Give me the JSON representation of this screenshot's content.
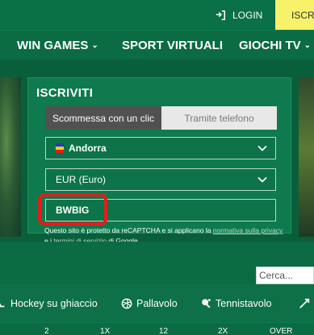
{
  "topbar": {
    "login_label": "LOGIN",
    "register_label": "ISCRI"
  },
  "nav": {
    "items": [
      {
        "label": "WIN GAMES",
        "has_dropdown": true
      },
      {
        "label": "SPORT VIRTUALI",
        "has_dropdown": false
      },
      {
        "label": "GIOCHI TV",
        "has_dropdown": true
      }
    ]
  },
  "registration": {
    "title": "ISCRIVITI",
    "tabs": [
      {
        "label": "Scommessa con un clic",
        "active": true
      },
      {
        "label": "Tramite telefono",
        "active": false
      }
    ],
    "country": "Andorra",
    "currency": "EUR (Euro)",
    "promo_code": "BWBIG",
    "captcha_text_1": "Questo sito è protetto da reCAPTCHA e si applicano la ",
    "captcha_link_1": "normativa sulla privacy",
    "captcha_text_2": " e i ",
    "captcha_link_2": "termini di servizio",
    "captcha_text_3": " di Google."
  },
  "search": {
    "placeholder": "Cerca..."
  },
  "sports": {
    "items": [
      {
        "label": "Hockey su ghiaccio",
        "icon": "hockey-icon"
      },
      {
        "label": "Pallavolo",
        "icon": "volleyball-icon"
      },
      {
        "label": "Tennistavolo",
        "icon": "table-tennis-icon"
      }
    ]
  },
  "bet_columns": [
    "2",
    "1X",
    "12",
    "2X",
    "OVER"
  ],
  "colors": {
    "brand_green": "#0b6b43",
    "register_yellow": "#f7f26a",
    "highlight_red": "#e11d1d"
  }
}
